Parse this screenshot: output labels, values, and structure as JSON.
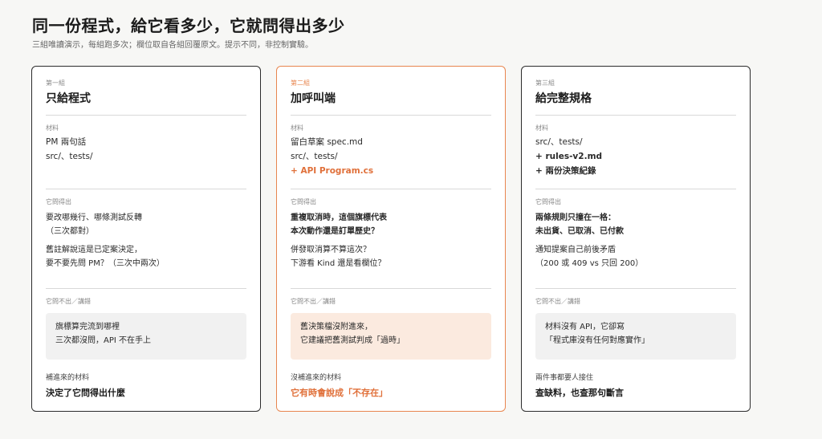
{
  "header": {
    "title": "同一份程式，給它看多少，它就問得出多少",
    "subtitle": "三組唯讀演示，每組跑多次；欄位取自各組回覆原文。提示不同，非控制實驗。"
  },
  "labels": {
    "materials": "材料",
    "asked": "它問得出",
    "missed": "它問不出／講錯"
  },
  "cards": [
    {
      "tag": "第一組",
      "title": "只給程式",
      "materials": [
        "PM 兩句話",
        "src/、tests/"
      ],
      "asked": [
        "要改哪幾行、哪條測試反轉\n（三次都對）",
        "舊註解說這是已定案決定，\n要不要先問 PM？（三次中兩次）"
      ],
      "missed": "旗標算完流到哪裡\n三次都沒問，API 不在手上",
      "foot_label": "補進來的材料",
      "foot_value": "決定了它問得出什麼"
    },
    {
      "tag": "第二組",
      "title": "加呼叫端",
      "materials": [
        "留白草案 spec.md",
        "src/、tests/",
        "+ API Program.cs"
      ],
      "asked": [
        "重複取消時，這個旗標代表\n本次動作還是訂單歷史？",
        "併發取消算不算這次？\n下游看 Kind 還是看欄位？"
      ],
      "missed": "舊決策檔沒附進來，\n它建議把舊測試判成「過時」",
      "foot_label": "沒補進來的材料",
      "foot_value": "它有時會說成「不存在」"
    },
    {
      "tag": "第三組",
      "title": "給完整規格",
      "materials": [
        "src/、tests/",
        "+ rules-v2.md",
        "+ 兩份決策紀錄"
      ],
      "asked": [
        "兩條規則只撞在一格：\n未出貨、已取消、已付款",
        "通知提案自己前後矛盾\n（200 或 409 vs 只回 200）"
      ],
      "missed": "材料沒有 API，它卻寫\n「程式庫沒有任何對應實作」",
      "foot_label": "兩件事都要人接住",
      "foot_value": "查缺料，也查那句斷言"
    }
  ],
  "colors": {
    "accent": "#e8864f",
    "accent_text": "#e0703a",
    "accent_box": "#fbeadf",
    "border": "#2c2c2c"
  }
}
